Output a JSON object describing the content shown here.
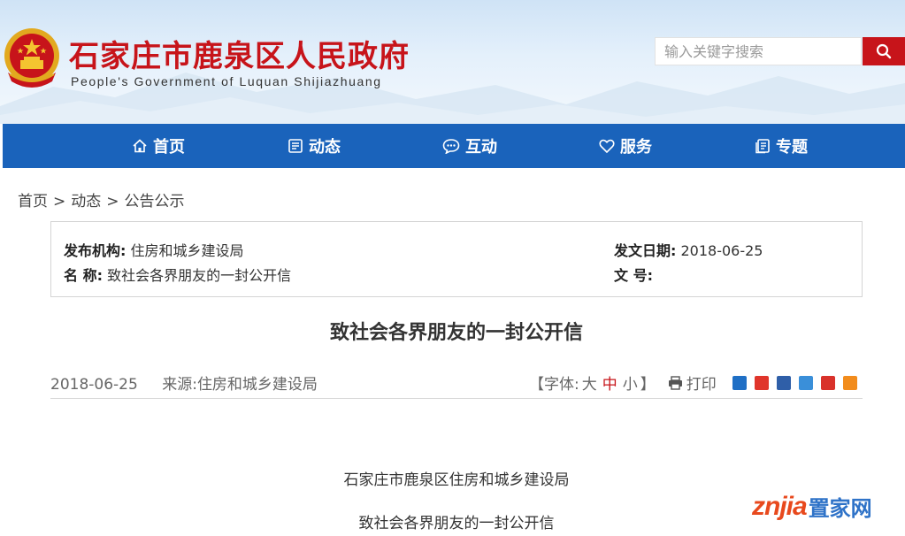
{
  "header": {
    "title": "石家庄市鹿泉区人民政府",
    "subtitle": "People's Government of Luquan Shijiazhuang",
    "search_placeholder": "输入关键字搜索"
  },
  "nav": [
    {
      "label": "首页",
      "icon": "home-icon"
    },
    {
      "label": "动态",
      "icon": "news-icon"
    },
    {
      "label": "互动",
      "icon": "chat-icon"
    },
    {
      "label": "服务",
      "icon": "heart-icon"
    },
    {
      "label": "专题",
      "icon": "topic-icon"
    }
  ],
  "breadcrumb": {
    "items": [
      "首页",
      "动态",
      "公告公示"
    ],
    "separator": ">"
  },
  "info": {
    "agency_label": "发布机构:",
    "agency_value": "住房和城乡建设局",
    "date_label": "发文日期:",
    "date_value": "2018-06-25",
    "name_label": "名 称:",
    "name_value": "致社会各界朋友的一封公开信",
    "doc_label": "文 号:",
    "doc_value": ""
  },
  "article": {
    "title": "致社会各界朋友的一封公开信",
    "date": "2018-06-25",
    "source_label": "来源:",
    "source_value": "住房和城乡建设局",
    "font_label_open": "【字体:",
    "font_sizes": [
      "大",
      "中",
      "小"
    ],
    "font_label_close": "】",
    "print_label": "打印",
    "share_colors": [
      "#1f6fc5",
      "#e0352b",
      "#2f5fa8",
      "#3a8fd9",
      "#d9322b",
      "#f28c1c"
    ],
    "body_lines": [
      "石家庄市鹿泉区住房和城乡建设局",
      "致社会各界朋友的一封公开信"
    ]
  },
  "watermark": {
    "brand": "znjia",
    "cn": "置家网"
  },
  "colors": {
    "brand_red": "#c7141a",
    "nav_blue": "#1a63bb"
  }
}
